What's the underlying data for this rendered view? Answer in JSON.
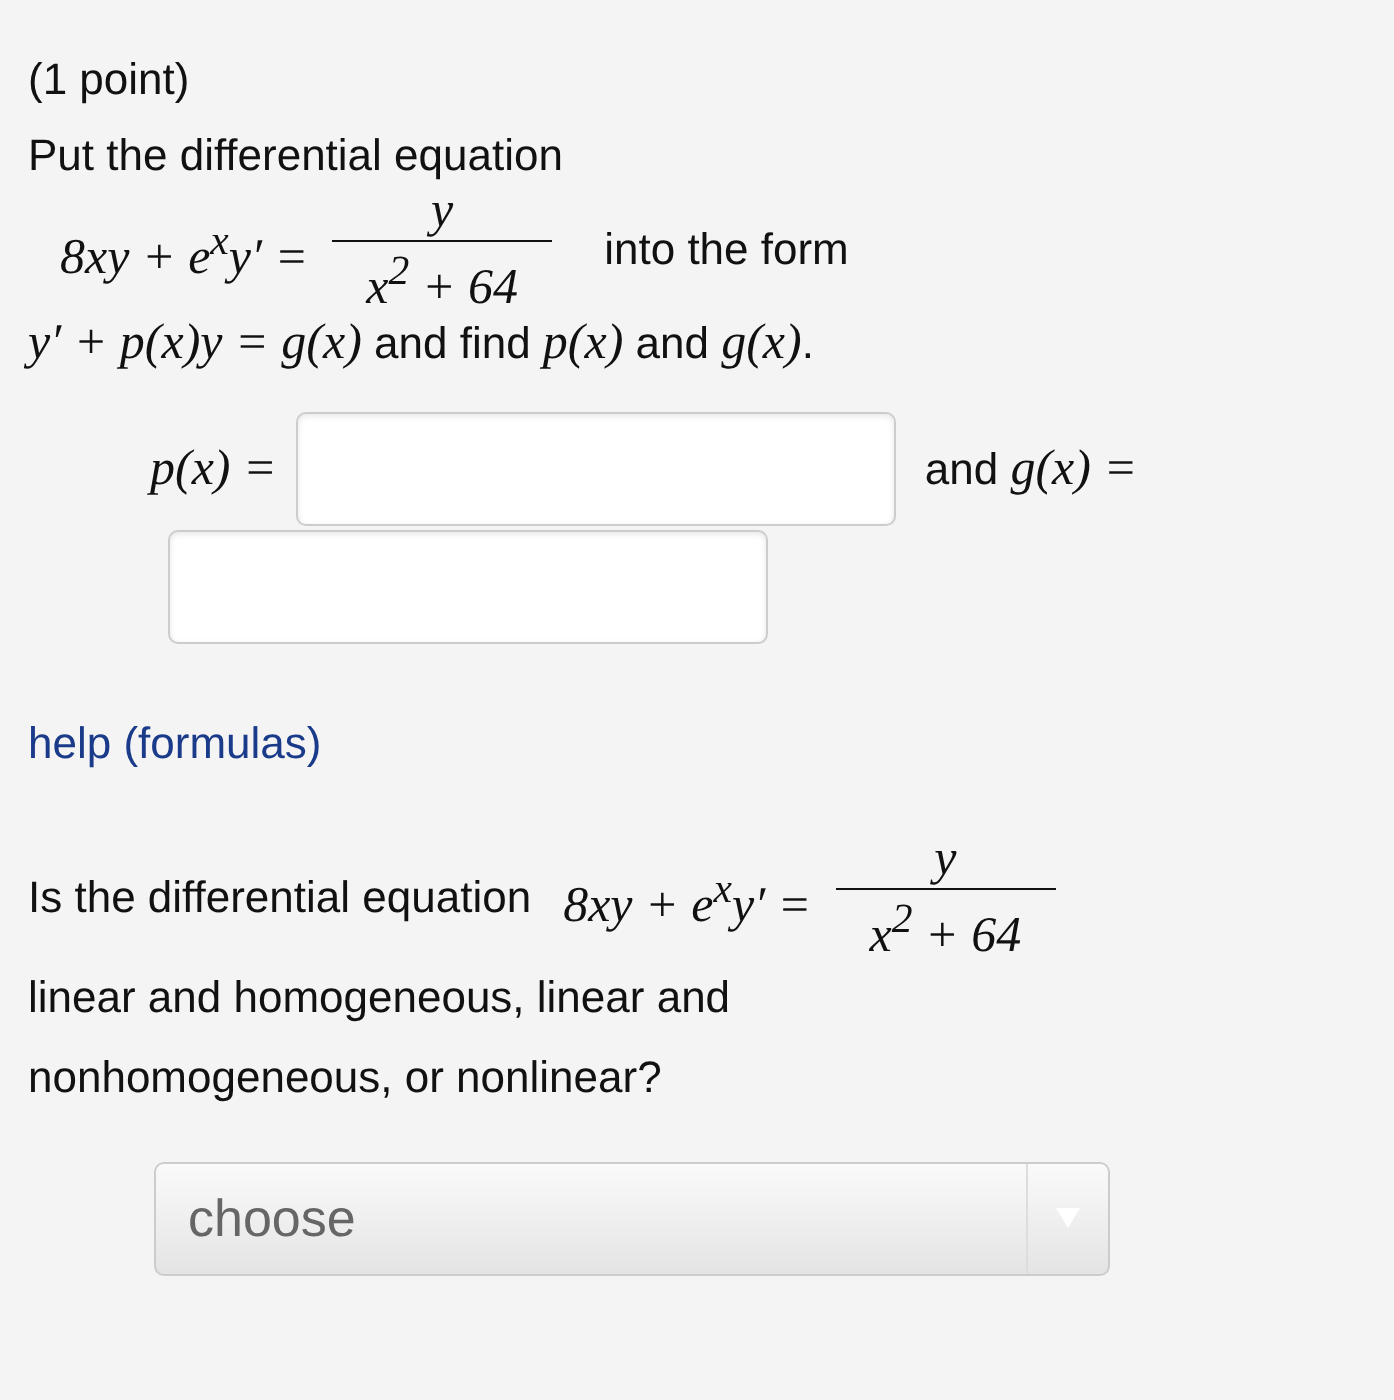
{
  "points": "(1 point)",
  "intro": "Put the differential equation",
  "equation": {
    "lhs": "8xy + e$^{x}$y′ =",
    "numerator": "y",
    "denominator": "x$^{2}$ + 64"
  },
  "after_equation": "into the form",
  "form_sentence": [
    {
      "kind": "math",
      "text": "y′ + p(x)y = g(x)"
    },
    {
      "kind": "text",
      "text": " and find "
    },
    {
      "kind": "math",
      "text": "p(x)"
    },
    {
      "kind": "text",
      "text": " and "
    },
    {
      "kind": "math",
      "text": "g(x)"
    },
    {
      "kind": "text",
      "text": "."
    }
  ],
  "answer_fields": [
    {
      "label": [
        {
          "kind": "math",
          "text": "p(x) ="
        }
      ]
    },
    {
      "label": [
        {
          "kind": "text",
          "text": "and "
        },
        {
          "kind": "math",
          "text": "g(x) ="
        }
      ]
    }
  ],
  "help_link": "help (formulas)",
  "question": {
    "lead": "Is the differential equation",
    "equation": {
      "lhs": "8xy + e$^{x}$y′ =",
      "numerator": "y",
      "denominator": "x$^{2}$ + 64"
    },
    "tail": "linear and homogeneous, linear and nonhomogeneous, or nonlinear?"
  },
  "dropdown": {
    "value": "choose"
  }
}
